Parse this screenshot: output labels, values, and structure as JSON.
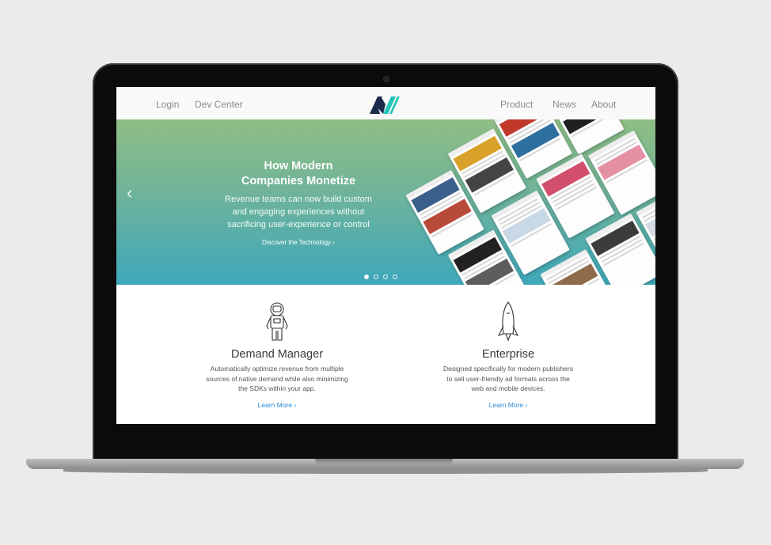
{
  "nav": {
    "login": "Login",
    "dev_center": "Dev Center",
    "product": "Product",
    "news": "News",
    "about": "About"
  },
  "hero": {
    "title_line1": "How Modern",
    "title_line2": "Companies Monetize",
    "subtitle_line1": "Revenue teams can now build custom",
    "subtitle_line2": "and engaging experiences without",
    "subtitle_line3": "sacrificing user-experience or control",
    "link": "Discover the Technology ›",
    "prev_arrow": "‹",
    "carousel_count": 4,
    "carousel_active": 1
  },
  "features": [
    {
      "title": "Demand Manager",
      "desc_line1": "Automatically optimize revenue from multiple",
      "desc_line2": "sources of native demand while also minimizing",
      "desc_line3": "the SDKs within your app.",
      "link": "Learn More ›",
      "icon": "astronaut-icon"
    },
    {
      "title": "Enterprise",
      "desc_line1": "Designed specifically for modern publishers",
      "desc_line2": "to sell user-friendly ad formats across the",
      "desc_line3": "web and mobile devices.",
      "link": "Learn More ›",
      "icon": "rocket-icon"
    }
  ],
  "colors": {
    "hero_top": "#8fbe84",
    "hero_bottom": "#3ea8bb",
    "link_blue": "#2a8ad3",
    "logo_dark": "#1d2b4a",
    "logo_teal": "#25c4b8"
  }
}
